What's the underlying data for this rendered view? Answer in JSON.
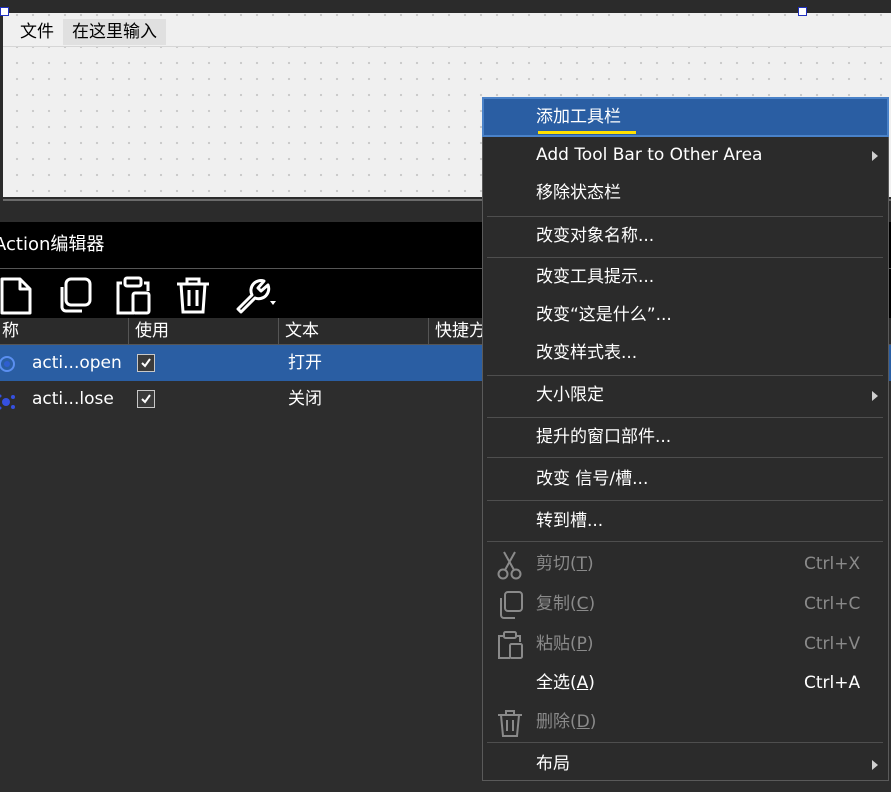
{
  "form": {
    "menubar": {
      "file": "文件",
      "type_here": "在这里输入"
    }
  },
  "action_editor": {
    "title": "Action编辑器",
    "toolbar": [
      {
        "icon": "new-action-icon"
      },
      {
        "icon": "copy-icon"
      },
      {
        "icon": "paste-icon"
      },
      {
        "icon": "delete-icon"
      },
      {
        "icon": "wrench-settings-icon"
      }
    ],
    "columns": [
      "称",
      "使用",
      "文本",
      "快捷方"
    ],
    "rows": [
      {
        "name": "acti...open",
        "used": true,
        "text": "打开",
        "selected": true
      },
      {
        "name": "acti...lose",
        "used": true,
        "text": "关闭",
        "selected": false
      }
    ]
  },
  "context_menu": {
    "add_toolbar": "添加工具栏",
    "add_toolbar_other": "Add Tool Bar to Other Area",
    "remove_statusbar": "移除状态栏",
    "change_object_name": "改变对象名称...",
    "change_tooltip": "改变工具提示...",
    "change_whatsthis": "改变“这是什么”...",
    "change_stylesheet": "改变样式表...",
    "size_constraints": "大小限定",
    "promoted_widgets": "提升的窗口部件...",
    "change_signals_slots": "改变 信号/槽...",
    "goto_slot": "转到槽...",
    "cut": "剪切",
    "cut_key": "T",
    "cut_shortcut": "Ctrl+X",
    "copy": "复制",
    "copy_key": "C",
    "copy_shortcut": "Ctrl+C",
    "paste": "粘贴",
    "paste_key": "P",
    "paste_shortcut": "Ctrl+V",
    "select_all": "全选",
    "select_all_key": "A",
    "select_all_shortcut": "Ctrl+A",
    "delete": "删除",
    "delete_key": "D",
    "layout": "布局",
    "highlight_color": "#2a5ea3",
    "underline_color": "#ffe000"
  }
}
